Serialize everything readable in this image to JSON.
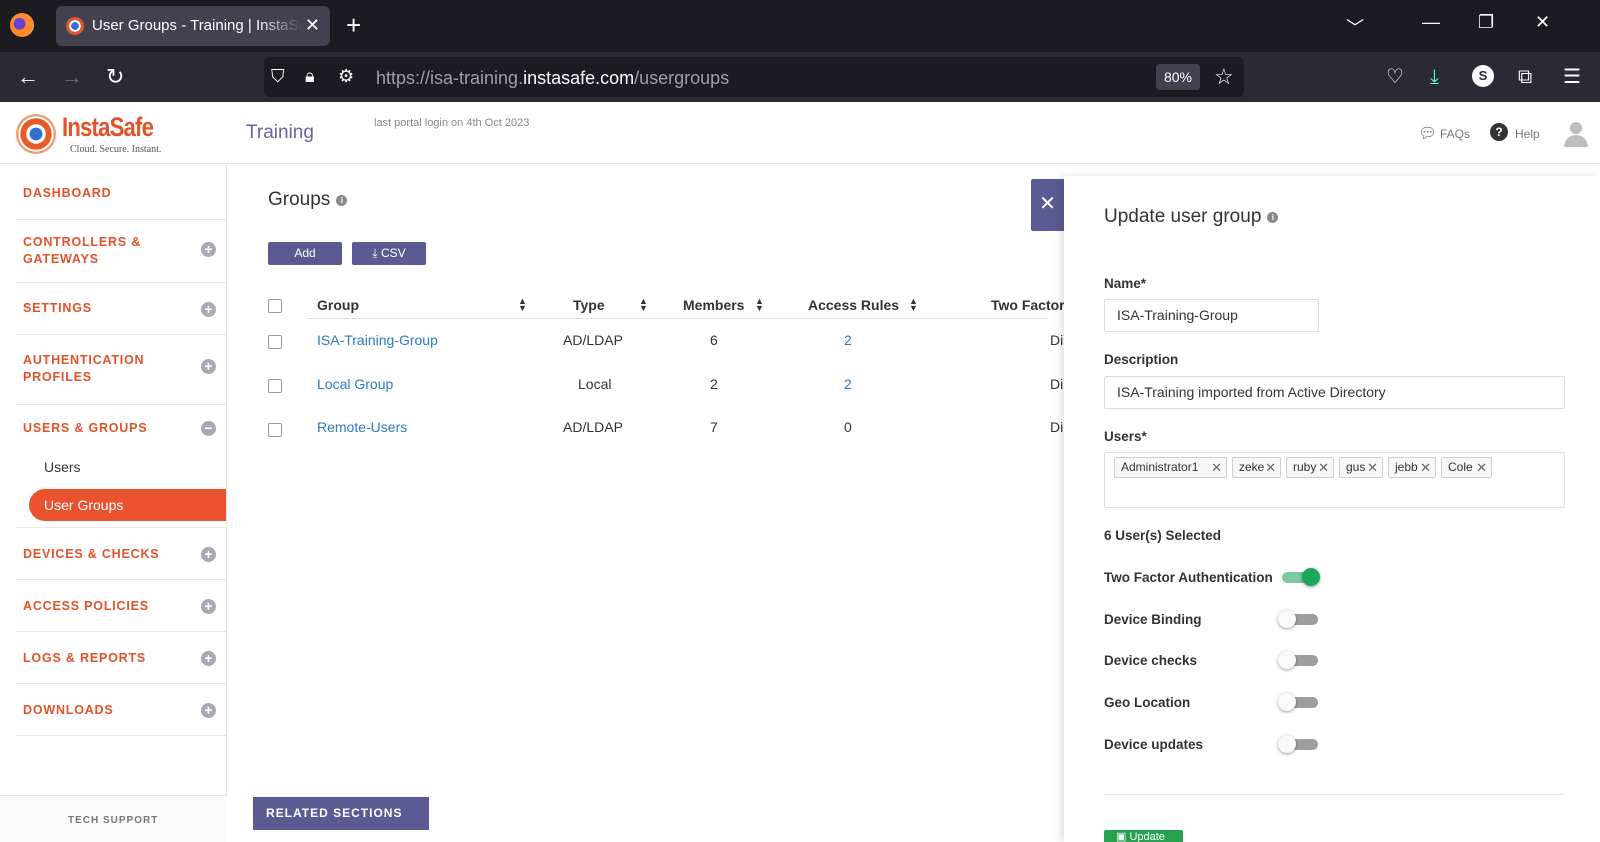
{
  "browser": {
    "tab_title": "User Groups - Training | InstaSafe",
    "url_prefix": "https://isa-training.",
    "url_domain": "instasafe.com",
    "url_path": "/usergroups",
    "zoom": "80%",
    "profile_initial": "S"
  },
  "header": {
    "brand": "InstaSafe",
    "tagline": "Cloud. Secure. Instant.",
    "portal_title": "Training",
    "last_login": "last portal login on 4th Oct 2023",
    "faqs": "FAQs",
    "help": "Help"
  },
  "sidebar": {
    "items": [
      {
        "label": "DASHBOARD"
      },
      {
        "label": "CONTROLLERS &",
        "label2": "GATEWAYS"
      },
      {
        "label": "SETTINGS"
      },
      {
        "label": "AUTHENTICATION",
        "label2": "PROFILES"
      },
      {
        "label": "USERS & GROUPS"
      },
      {
        "label": "DEVICES & CHECKS"
      },
      {
        "label": "ACCESS POLICIES"
      },
      {
        "label": "LOGS & REPORTS"
      },
      {
        "label": "DOWNLOADS"
      }
    ],
    "sub_items": [
      "Users",
      "User Groups"
    ],
    "tech_support": "TECH SUPPORT"
  },
  "main": {
    "title": "Groups",
    "add_label": "Add",
    "csv_label": "CSV",
    "columns": [
      "Group",
      "Type",
      "Members",
      "Access Rules",
      "Two Factor"
    ],
    "rows": [
      {
        "group": "ISA-Training-Group",
        "type": "AD/LDAP",
        "members": "6",
        "rules": "2",
        "two_factor": "Di"
      },
      {
        "group": "Local Group",
        "type": "Local",
        "members": "2",
        "rules": "2",
        "two_factor": "Di"
      },
      {
        "group": "Remote-Users",
        "type": "AD/LDAP",
        "members": "7",
        "rules": "0",
        "two_factor": "Di"
      }
    ],
    "related_sections": "RELATED SECTIONS"
  },
  "panel": {
    "title": "Update user group",
    "name_label": "Name*",
    "name_value": "ISA-Training-Group",
    "description_label": "Description",
    "description_value": "ISA-Training imported from Active Directory",
    "users_label": "Users*",
    "users": [
      "Administrator1",
      "zeke",
      "ruby",
      "gus",
      "jebb",
      "Cole"
    ],
    "selected_count": "6 User(s) Selected",
    "toggles": [
      {
        "label": "Two Factor Authentication",
        "on": true
      },
      {
        "label": "Device Binding",
        "on": false
      },
      {
        "label": "Device checks",
        "on": false
      },
      {
        "label": "Geo Location",
        "on": false
      },
      {
        "label": "Device updates",
        "on": false
      }
    ],
    "update_label": "Update"
  },
  "colors": {
    "accent_orange": "#e4522a",
    "brand_purple": "#5c5a93",
    "link_blue": "#2a7bc0",
    "toggle_green": "#1aa85a"
  }
}
